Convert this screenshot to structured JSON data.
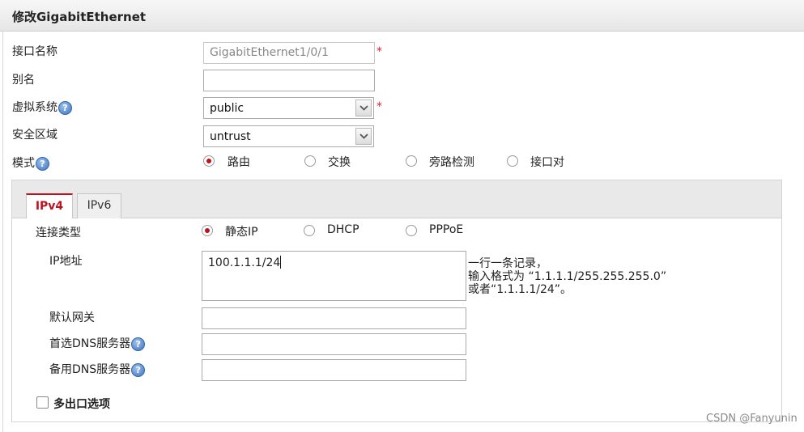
{
  "window": {
    "title": "修改GigabitEthernet"
  },
  "form": {
    "interface_name": {
      "label": "接口名称",
      "value": "GigabitEthernet1/0/1",
      "required": "*"
    },
    "alias": {
      "label": "别名",
      "value": ""
    },
    "vsys": {
      "label": "虚拟系统",
      "value": "public",
      "required": "*",
      "help_icon": "?"
    },
    "zone": {
      "label": "安全区域",
      "value": "untrust"
    },
    "mode": {
      "label": "模式",
      "help_icon": "?",
      "options": [
        "路由",
        "交换",
        "旁路检测",
        "接口对"
      ],
      "selected": "路由"
    }
  },
  "tabs": [
    {
      "label": "IPv4",
      "active": true
    },
    {
      "label": "IPv6",
      "active": false
    }
  ],
  "ipv4": {
    "conn_type": {
      "label": "连接类型",
      "options": [
        "静态IP",
        "DHCP",
        "PPPoE"
      ],
      "selected": "静态IP"
    },
    "ip_addr": {
      "label": "IP地址",
      "value": "100.1.1.1/24",
      "hint_lines": [
        "一行一条记录，",
        "输入格式为 “1.1.1.1/255.255.255.0”",
        "或者“1.1.1.1/24”。"
      ]
    },
    "gateway": {
      "label": "默认网关",
      "value": ""
    },
    "dns_primary": {
      "label": "首选DNS服务器",
      "value": "",
      "help_icon": "?"
    },
    "dns_backup": {
      "label": "备用DNS服务器",
      "value": "",
      "help_icon": "?"
    }
  },
  "multi_exit": {
    "label": "多出口选项",
    "checked": false
  },
  "watermark": "CSDN @Fanyunin",
  "colors": {
    "accent": "#c0121e",
    "required": "#d9232d",
    "help": "#3a72c2"
  }
}
